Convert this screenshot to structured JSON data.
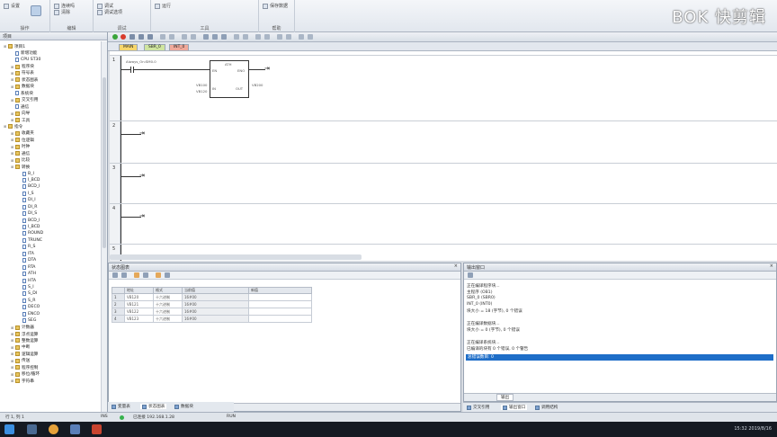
{
  "watermark": "BOK 快剪辑",
  "ribbon": {
    "items": [
      "连续吗",
      "设置",
      "清除",
      "调试",
      "调试选项",
      "运行",
      "保存数据"
    ],
    "groups": [
      "操作",
      "编辑",
      "调试",
      "工具",
      "帮助"
    ]
  },
  "tree": {
    "title": "项目",
    "nodes": [
      {
        "label": "项目1",
        "indent": 0,
        "type": "fold"
      },
      {
        "label": "新增功能",
        "indent": 1,
        "type": "doc"
      },
      {
        "label": "CPU ST30",
        "indent": 1,
        "type": "doc"
      },
      {
        "label": "程序块",
        "indent": 1,
        "type": "fold"
      },
      {
        "label": "符号表",
        "indent": 1,
        "type": "fold"
      },
      {
        "label": "状态图表",
        "indent": 1,
        "type": "fold"
      },
      {
        "label": "数据块",
        "indent": 1,
        "type": "fold"
      },
      {
        "label": "系统块",
        "indent": 1,
        "type": "doc"
      },
      {
        "label": "交叉引用",
        "indent": 1,
        "type": "fold"
      },
      {
        "label": "通信",
        "indent": 1,
        "type": "doc"
      },
      {
        "label": "向导",
        "indent": 1,
        "type": "fold"
      },
      {
        "label": "工具",
        "indent": 1,
        "type": "fold"
      },
      {
        "label": "指令",
        "indent": 0,
        "type": "fold"
      },
      {
        "label": "收藏夹",
        "indent": 1,
        "type": "fold"
      },
      {
        "label": "位逻辑",
        "indent": 1,
        "type": "fold"
      },
      {
        "label": "时钟",
        "indent": 1,
        "type": "fold"
      },
      {
        "label": "通信",
        "indent": 1,
        "type": "fold"
      },
      {
        "label": "比较",
        "indent": 1,
        "type": "fold"
      },
      {
        "label": "转换",
        "indent": 1,
        "type": "fold"
      },
      {
        "label": "B_I",
        "indent": 2,
        "type": "doc"
      },
      {
        "label": "I_BCD",
        "indent": 2,
        "type": "doc"
      },
      {
        "label": "BCD_I",
        "indent": 2,
        "type": "doc"
      },
      {
        "label": "I_S",
        "indent": 2,
        "type": "doc"
      },
      {
        "label": "DI_I",
        "indent": 2,
        "type": "doc"
      },
      {
        "label": "DI_R",
        "indent": 2,
        "type": "doc"
      },
      {
        "label": "DI_S",
        "indent": 2,
        "type": "doc"
      },
      {
        "label": "BCD_I",
        "indent": 2,
        "type": "doc"
      },
      {
        "label": "I_BCD",
        "indent": 2,
        "type": "doc"
      },
      {
        "label": "ROUND",
        "indent": 2,
        "type": "doc"
      },
      {
        "label": "TRUNC",
        "indent": 2,
        "type": "doc"
      },
      {
        "label": "R_S",
        "indent": 2,
        "type": "doc"
      },
      {
        "label": "ITA",
        "indent": 2,
        "type": "doc"
      },
      {
        "label": "DTA",
        "indent": 2,
        "type": "doc"
      },
      {
        "label": "RTA",
        "indent": 2,
        "type": "doc"
      },
      {
        "label": "ATH",
        "indent": 2,
        "type": "doc"
      },
      {
        "label": "HTA",
        "indent": 2,
        "type": "doc"
      },
      {
        "label": "S_I",
        "indent": 2,
        "type": "doc"
      },
      {
        "label": "S_DI",
        "indent": 2,
        "type": "doc"
      },
      {
        "label": "S_R",
        "indent": 2,
        "type": "doc"
      },
      {
        "label": "DECO",
        "indent": 2,
        "type": "doc"
      },
      {
        "label": "ENCO",
        "indent": 2,
        "type": "doc"
      },
      {
        "label": "SEG",
        "indent": 2,
        "type": "doc"
      },
      {
        "label": "计数器",
        "indent": 1,
        "type": "fold"
      },
      {
        "label": "浮点运算",
        "indent": 1,
        "type": "fold"
      },
      {
        "label": "整数运算",
        "indent": 1,
        "type": "fold"
      },
      {
        "label": "中断",
        "indent": 1,
        "type": "fold"
      },
      {
        "label": "逻辑运算",
        "indent": 1,
        "type": "fold"
      },
      {
        "label": "传送",
        "indent": 1,
        "type": "fold"
      },
      {
        "label": "程序控制",
        "indent": 1,
        "type": "fold"
      },
      {
        "label": "移位/循环",
        "indent": 1,
        "type": "fold"
      },
      {
        "label": "字符串",
        "indent": 1,
        "type": "fold"
      }
    ]
  },
  "editor": {
    "tabs": [
      "MAIN",
      "SBR_0",
      "INT_0"
    ],
    "networks": [
      {
        "num": "1",
        "contact_label": "Always_On:SM0.0",
        "block": "ATH",
        "pins_in": [
          "EN",
          "IN"
        ],
        "pins_out": [
          "ENO",
          "OUT"
        ],
        "in_addr": "VB100",
        "len_label": "LEN",
        "len_addr": "VB120",
        "out_addr": "VB200"
      },
      {
        "num": "2"
      },
      {
        "num": "3"
      },
      {
        "num": "4"
      },
      {
        "num": "5"
      }
    ]
  },
  "status_chart": {
    "title": "状态图表",
    "headers": [
      "",
      "地址",
      "格式",
      "当前值",
      "新值"
    ],
    "rows": [
      [
        "1",
        "VB120",
        "十六进制",
        "16#00"
      ],
      [
        "2",
        "VB121",
        "十六进制",
        "16#00"
      ],
      [
        "3",
        "VB122",
        "十六进制",
        "16#00"
      ],
      [
        "4",
        "VB123",
        "十六进制",
        "16#00"
      ]
    ],
    "sheet_tab": "图表 1"
  },
  "output": {
    "title": "输出窗口",
    "lines": [
      "正在编译程序块...",
      "主程序 (OB1)",
      "SBR_0 (SBR0)",
      "INT_0 (INT0)",
      "块大小 = 18 (字节), 0 个错误",
      "",
      "正在编译数据块...",
      "块大小 = 0 (字节), 0 个错误",
      "",
      "正在编译系统块...",
      "已编译的块有 0 个错误, 0 个警告"
    ],
    "highlight": "总错误数目: 0",
    "tab": "输出"
  },
  "bottom_tabs_left": [
    "变量表",
    "状态图表",
    "数据块"
  ],
  "bottom_tabs_right": [
    "交叉引用",
    "输出窗口",
    "调用结构"
  ],
  "statusbar": {
    "left": "行 1, 列 1",
    "ins": "INS",
    "conn": "已连接 192.168.1.28",
    "run": "RUN"
  },
  "taskbar": {
    "tray": "15:32 2019/8/16"
  },
  "colors": {
    "highlight": "#1e6ec8",
    "tab_main": "#f7d66a",
    "tab_sbr": "#cfe5a0",
    "tab_int": "#f0a99a"
  }
}
